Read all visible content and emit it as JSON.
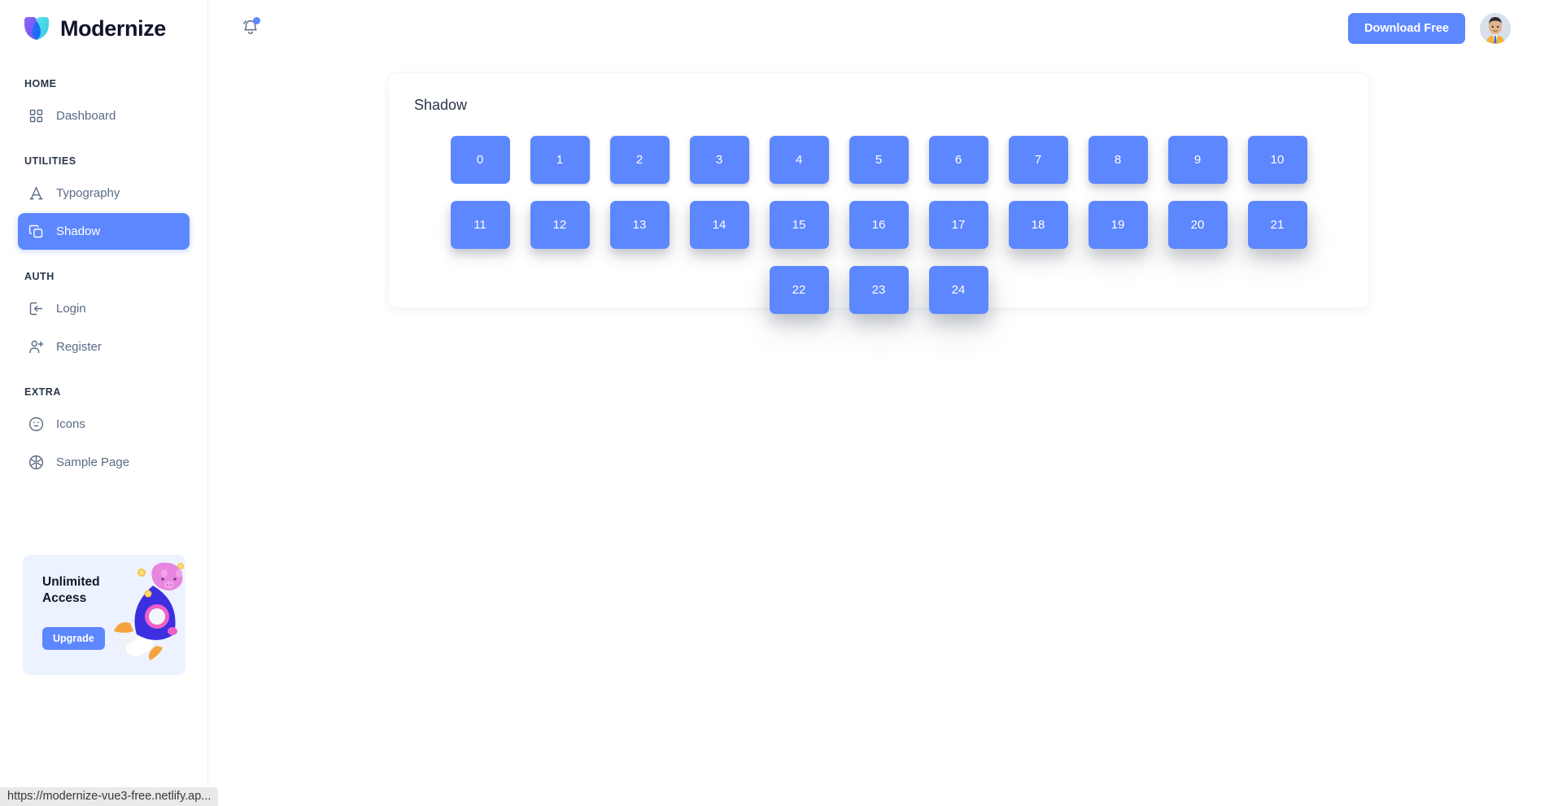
{
  "brand": {
    "name": "Modernize",
    "logo_icon": "modernize-logo-icon",
    "colors": {
      "violet": "#7b5cf0",
      "cyan": "#49d8e8",
      "blue": "#1b6ef3"
    }
  },
  "colors": {
    "accent": "#5D87FF",
    "sidebar_text": "#5A6A85",
    "heading": "#2A3547",
    "promo_bg": "#ECF2FF",
    "box_blue": "#5D87FF"
  },
  "sidebar": {
    "sections": [
      {
        "title": "HOME",
        "items": [
          {
            "label": "Dashboard",
            "icon": "layout-grid-icon",
            "active": false
          }
        ]
      },
      {
        "title": "UTILITIES",
        "items": [
          {
            "label": "Typography",
            "icon": "typography-a-icon",
            "active": false
          },
          {
            "label": "Shadow",
            "icon": "copy-layers-icon",
            "active": true
          }
        ]
      },
      {
        "title": "AUTH",
        "items": [
          {
            "label": "Login",
            "icon": "login-arrow-icon",
            "active": false
          },
          {
            "label": "Register",
            "icon": "user-plus-icon",
            "active": false
          }
        ]
      },
      {
        "title": "EXTRA",
        "items": [
          {
            "label": "Icons",
            "icon": "smiley-face-icon",
            "active": false
          },
          {
            "label": "Sample Page",
            "icon": "aperture-icon",
            "active": false
          }
        ]
      }
    ],
    "promo": {
      "title": "Unlimited Access",
      "button_label": "Upgrade",
      "illustration_icon": "rocket-piggy-bank-illustration"
    }
  },
  "header": {
    "notifications": {
      "icon": "bell-icon",
      "has_unread_dot": true
    },
    "download_button": {
      "label": "Download Free"
    },
    "avatar": {
      "icon": "user-avatar",
      "alt": "User profile"
    }
  },
  "main": {
    "card": {
      "title": "Shadow",
      "boxes": [
        "0",
        "1",
        "2",
        "3",
        "4",
        "5",
        "6",
        "7",
        "8",
        "9",
        "10",
        "11",
        "12",
        "13",
        "14",
        "15",
        "16",
        "17",
        "18",
        "19",
        "20",
        "21",
        "22",
        "23",
        "24"
      ]
    }
  },
  "status_bar": {
    "url": "https://modernize-vue3-free.netlify.ap..."
  }
}
